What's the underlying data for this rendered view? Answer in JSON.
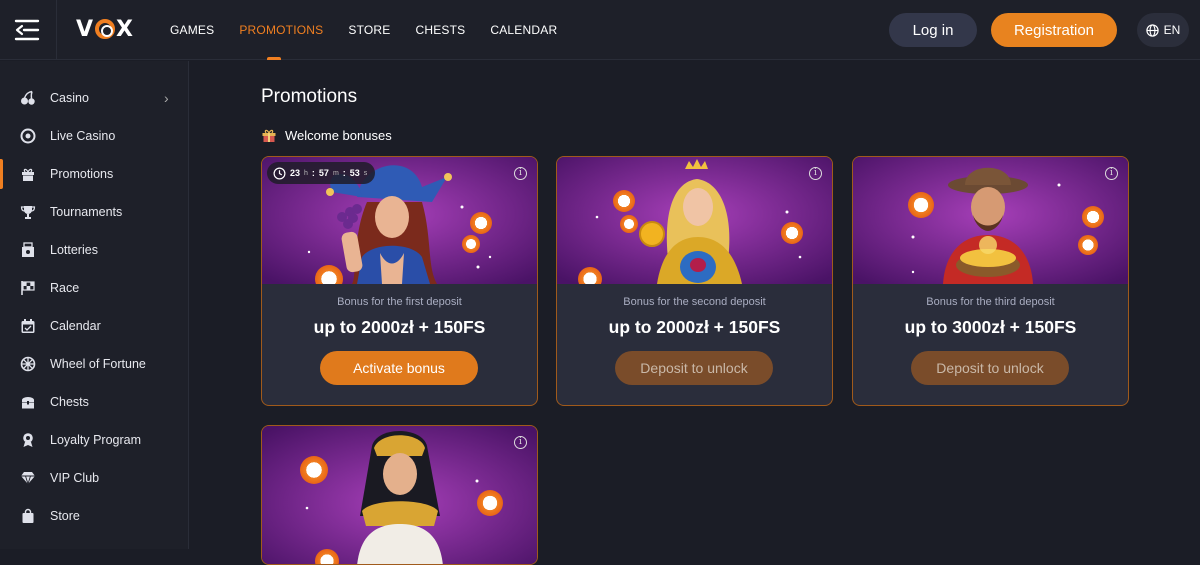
{
  "header": {
    "logo": "VOX",
    "nav": [
      "GAMES",
      "PROMOTIONS",
      "STORE",
      "CHESTS",
      "CALENDAR"
    ],
    "active_nav": "PROMOTIONS",
    "login_label": "Log in",
    "register_label": "Registration",
    "language": "EN"
  },
  "sidebar": {
    "items": [
      {
        "label": "Casino",
        "icon": "cherries-icon"
      },
      {
        "label": "Live Casino",
        "icon": "casino-chip-icon"
      },
      {
        "label": "Promotions",
        "icon": "gift-icon"
      },
      {
        "label": "Tournaments",
        "icon": "trophy-icon"
      },
      {
        "label": "Lotteries",
        "icon": "lottery-icon"
      },
      {
        "label": "Race",
        "icon": "checkered-flag-icon"
      },
      {
        "label": "Calendar",
        "icon": "calendar-icon"
      },
      {
        "label": "Wheel of Fortune",
        "icon": "wheel-icon"
      },
      {
        "label": "Chests",
        "icon": "chest-icon"
      },
      {
        "label": "Loyalty Program",
        "icon": "medal-icon"
      },
      {
        "label": "VIP Club",
        "icon": "diamond-icon"
      },
      {
        "label": "Store",
        "icon": "shopping-bag-icon"
      }
    ]
  },
  "main": {
    "title": "Promotions",
    "section_title": "Welcome bonuses",
    "cards": [
      {
        "subtitle": "Bonus for the first deposit",
        "amount": "up to 2000zł + 150FS",
        "action": "Activate bonus",
        "character": "jester-woman"
      },
      {
        "subtitle": "Bonus for the second deposit",
        "amount": "up to 2000zł + 150FS",
        "action": "Deposit to unlock",
        "character": "queen"
      },
      {
        "subtitle": "Bonus for the third deposit",
        "amount": "up to 3000zł + 150FS",
        "action": "Deposit to unlock",
        "character": "cowboy"
      }
    ],
    "timer": {
      "hours": "23",
      "minutes": "57",
      "seconds": "53",
      "h": "h",
      "m": "m",
      "s": "s"
    }
  },
  "colors": {
    "accent": "#f07f21",
    "card_border": "#a05a1b",
    "background": "#1b1d26"
  }
}
